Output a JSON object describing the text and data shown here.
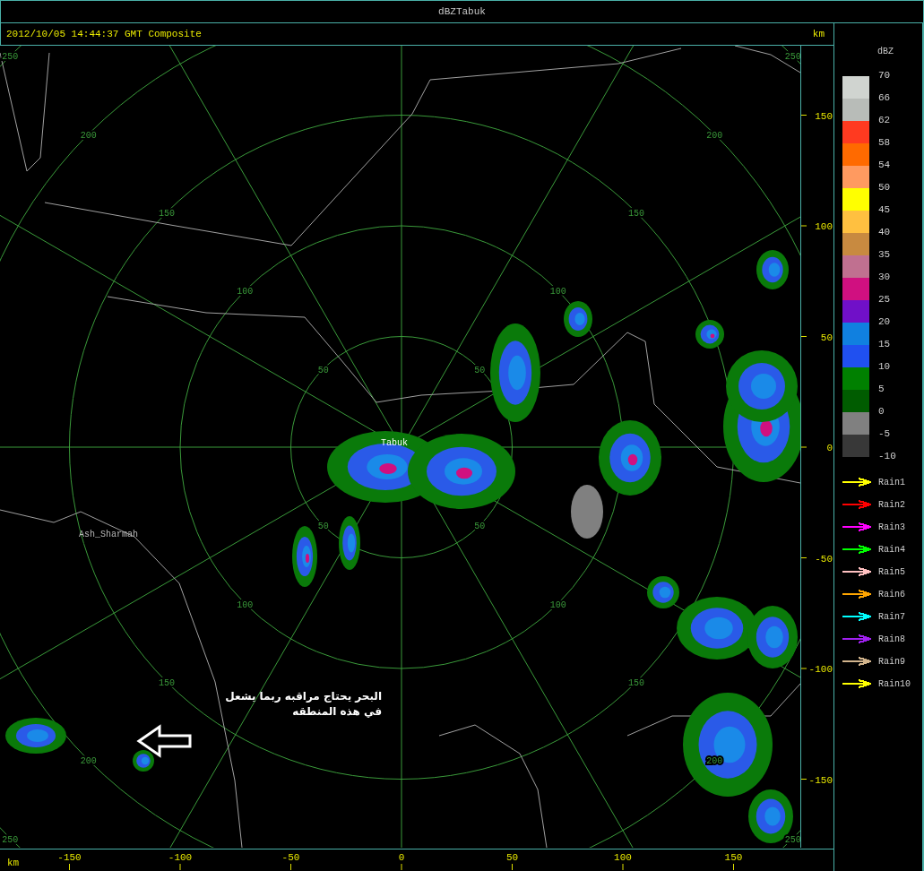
{
  "window": {
    "title": "dBZTabuk"
  },
  "header": {
    "info": "2012/10/05 14:44:37 GMT Composite",
    "unit": "km"
  },
  "map": {
    "range_rings": [
      {
        "labels": [
          "50",
          "50",
          "50",
          "50"
        ]
      },
      {
        "labels": [
          "100",
          "100",
          "100",
          "100"
        ]
      },
      {
        "labels": [
          "150",
          "150",
          "150",
          "150"
        ]
      },
      {
        "labels": [
          "200",
          "200",
          "200",
          "200"
        ]
      },
      {
        "labels": [
          "250",
          "250",
          "250",
          "250"
        ]
      }
    ],
    "places": [
      {
        "name": "Tabuk",
        "kind": "radar"
      },
      {
        "name": "Ash_Sharmah",
        "kind": "town"
      }
    ],
    "annotation": {
      "lines": [
        "البحر يحتاج مراقبه ربما يشعل",
        "في هذه المنطقه"
      ]
    }
  },
  "right_axis": {
    "ticks": [
      "150",
      "100",
      "50",
      "0",
      "-50",
      "-100",
      "-150"
    ]
  },
  "bottom_axis": {
    "unit": "km",
    "ticks": [
      "-150",
      "-100",
      "-50",
      "0",
      "50",
      "100",
      "150"
    ]
  },
  "legend": {
    "title": "dBZ",
    "scale": [
      {
        "color": "#d0d4d0"
      },
      {
        "color": "#b8bcb8"
      },
      {
        "color": "#ff3a20"
      },
      {
        "color": "#ff6a00"
      },
      {
        "color": "#ff9a60"
      },
      {
        "color": "#ffff00"
      },
      {
        "color": "#ffc040"
      },
      {
        "color": "#c88a40"
      },
      {
        "color": "#c07090"
      },
      {
        "color": "#d01080"
      },
      {
        "color": "#7010c8"
      },
      {
        "color": "#1080e0"
      },
      {
        "color": "#2050f0"
      },
      {
        "color": "#008000"
      },
      {
        "color": "#005c00"
      },
      {
        "color": "#808080"
      },
      {
        "color": "#383838"
      }
    ],
    "scale_labels": [
      "70",
      "66",
      "62",
      "58",
      "54",
      "50",
      "45",
      "40",
      "35",
      "30",
      "25",
      "20",
      "15",
      "10",
      "5",
      "0",
      "-5",
      "-10"
    ],
    "tracks": [
      {
        "name": "Rain1",
        "color": "#ffff00"
      },
      {
        "name": "Rain2",
        "color": "#ff0000"
      },
      {
        "name": "Rain3",
        "color": "#ff00ff"
      },
      {
        "name": "Rain4",
        "color": "#00ff00"
      },
      {
        "name": "Rain5",
        "color": "#ffc0c0"
      },
      {
        "name": "Rain6",
        "color": "#ffa500"
      },
      {
        "name": "Rain7",
        "color": "#00ffff"
      },
      {
        "name": "Rain8",
        "color": "#a020f0"
      },
      {
        "name": "Rain9",
        "color": "#d2b48c"
      },
      {
        "name": "Rain10",
        "color": "#ffff00"
      }
    ]
  }
}
